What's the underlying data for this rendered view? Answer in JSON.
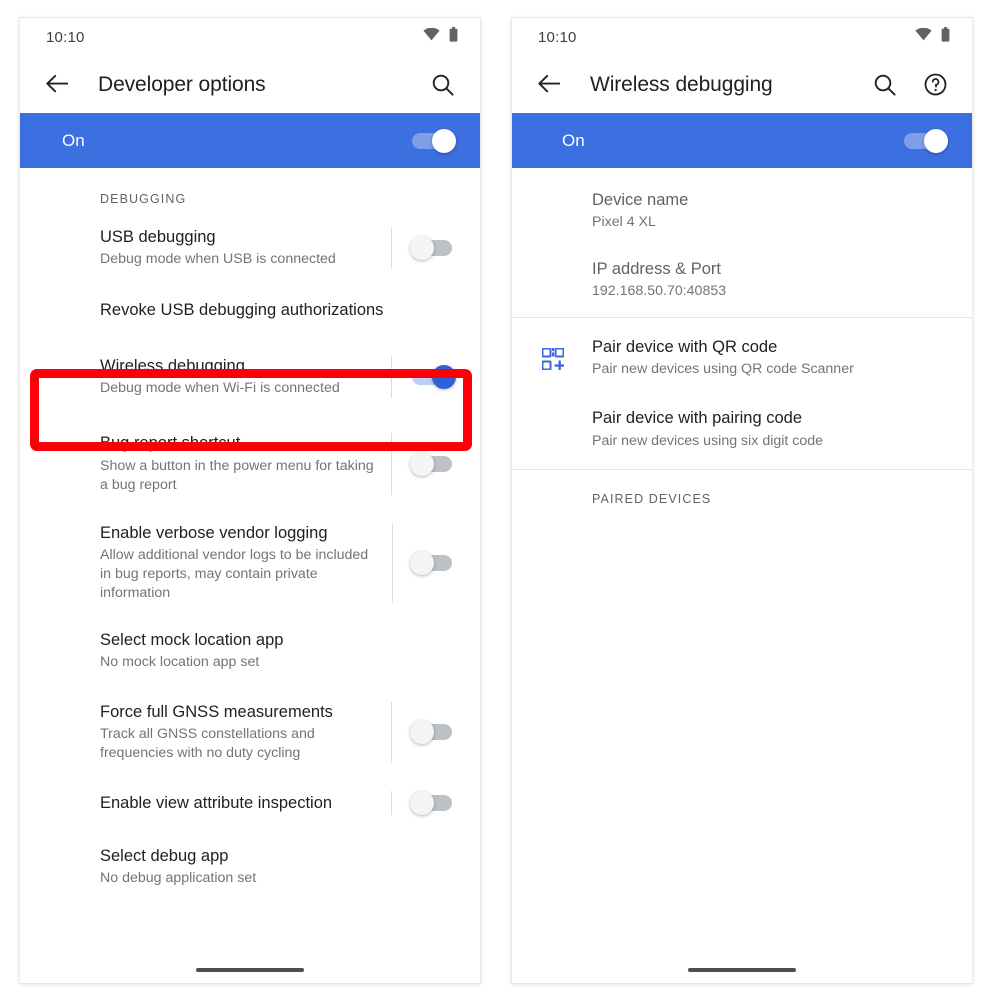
{
  "panels": [
    {
      "id": "developer-options",
      "statusbar": {
        "clock": "10:10",
        "wifi_icon": "wifi-icon",
        "battery_icon": "battery-icon"
      },
      "appbar": {
        "back_icon": "back-arrow-icon",
        "title": "Developer options",
        "actions": [
          {
            "icon": "search-icon"
          }
        ]
      },
      "master": {
        "label": "On",
        "state": "on",
        "toggle_icon": "toggle-switch-on"
      },
      "section_header": "DEBUGGING",
      "rows": [
        {
          "title": "USB debugging",
          "subtitle": "Debug mode when USB is connected",
          "toggle": "off"
        },
        {
          "title": "Revoke USB debugging authorizations",
          "subtitle": "",
          "toggle": "none"
        },
        {
          "title": "Wireless debugging",
          "subtitle": "Debug mode when Wi-Fi is connected",
          "toggle": "blue-on",
          "highlighted": true
        },
        {
          "title": "Bug report shortcut",
          "subtitle": "Show a button in the power menu for taking a bug report",
          "toggle": "off"
        },
        {
          "title": "Enable verbose vendor logging",
          "subtitle": "Allow additional vendor logs to be included in bug reports, may contain private information",
          "toggle": "off"
        },
        {
          "title": "Select mock location app",
          "subtitle": "No mock location app set",
          "toggle": "none"
        },
        {
          "title": "Force full GNSS measurements",
          "subtitle": "Track all GNSS constellations and frequencies with no duty cycling",
          "toggle": "off"
        },
        {
          "title": "Enable view attribute inspection",
          "subtitle": "",
          "toggle": "off"
        },
        {
          "title": "Select debug app",
          "subtitle": "No debug application set",
          "toggle": "none"
        }
      ]
    },
    {
      "id": "wireless-debugging",
      "statusbar": {
        "clock": "10:10",
        "wifi_icon": "wifi-icon",
        "battery_icon": "battery-icon"
      },
      "appbar": {
        "back_icon": "back-arrow-icon",
        "title": "Wireless debugging",
        "actions": [
          {
            "icon": "search-icon"
          },
          {
            "icon": "help-icon"
          }
        ]
      },
      "master": {
        "label": "On",
        "state": "on",
        "toggle_icon": "toggle-switch-on"
      },
      "info_rows": [
        {
          "title": "Device name",
          "subtitle": "Pixel 4 XL"
        },
        {
          "title": "IP address & Port",
          "subtitle": "192.168.50.70:40853"
        }
      ],
      "pair_rows": [
        {
          "icon": "qr-code-icon",
          "title": "Pair device with QR code",
          "subtitle": "Pair new devices using QR code Scanner"
        },
        {
          "icon": "none",
          "title": "Pair device with pairing code",
          "subtitle": "Pair new devices using six digit code"
        }
      ],
      "section_header": "PAIRED DEVICES",
      "paired_devices": []
    }
  ],
  "colors": {
    "accent_blue": "#3c6fe0",
    "toggle_on_blue": "#2f62d8",
    "qr_icon_blue": "#3b68d8",
    "highlight_red": "#fb0007",
    "title_text": "#202124",
    "subtitle_text": "#70757a",
    "section_text": "#5f6368"
  }
}
